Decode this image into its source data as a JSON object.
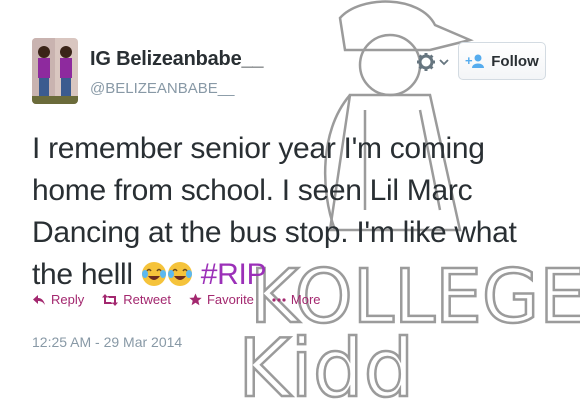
{
  "tweet": {
    "display_name": "IG Belizeanbabe__",
    "handle": "@BELIZEANBABE__",
    "text_parts": [
      "I remember senior year I'm coming home from school.  I seen Lil Marc Dancing at the bus stop. I'm like what the helll "
    ],
    "emojis": [
      "joy-tears-emoji",
      "joy-tears-emoji"
    ],
    "hashtag": "#RIP",
    "timestamp": "12:25 AM - 29 Mar 2014"
  },
  "header": {
    "gear_icon": "gear-icon",
    "follow_label": "Follow",
    "follow_icon": "add-user-icon"
  },
  "actions": {
    "reply_label": "Reply",
    "retweet_label": "Retweet",
    "favorite_label": "Favorite",
    "more_label": "More"
  },
  "watermark": {
    "line1": "KOLLEGE",
    "line2": "Kidd"
  },
  "colors": {
    "accent": "#a3286f",
    "hashtag": "#9b30b8",
    "text": "#292f33",
    "muted": "#8899a6"
  }
}
